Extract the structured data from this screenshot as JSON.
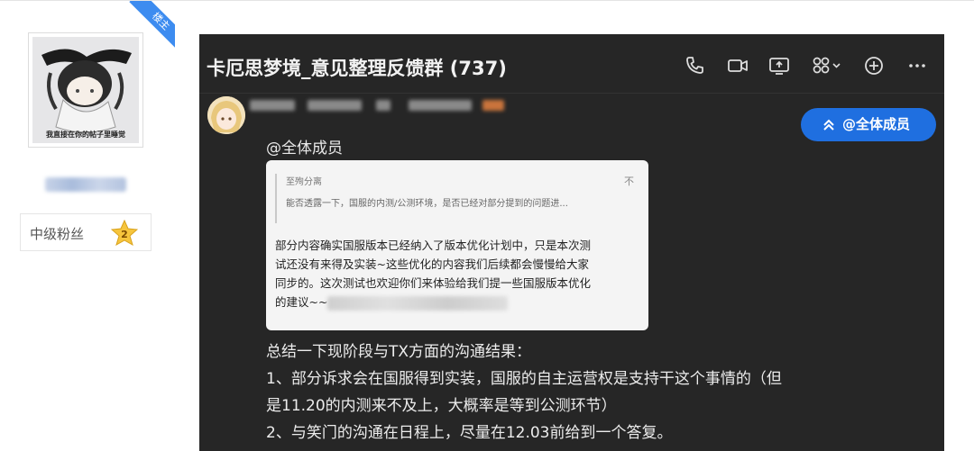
{
  "poster": {
    "badge": "楼主",
    "avatar_caption": "我直接在你的帖子里睡觉",
    "fan_level_label": "中级粉丝",
    "fan_level_number": "2"
  },
  "chat": {
    "title": "卡厄思梦境_意见整理反馈群 (737)",
    "header_icons": [
      "phone-icon",
      "video-icon",
      "screen-share-icon",
      "apps-icon",
      "add-circle-icon",
      "more-icon"
    ],
    "mention_all_button": "@全体成员",
    "mention_text": "@全体成员",
    "quote": {
      "label": "至殉分离",
      "close": "不",
      "snippet": "能否透露一下，国服的内测/公测环境，是否已经对部分提到的问题进...",
      "reply_lines": [
        "部分内容确实国服版本已经纳入了版本优化计划中，只是本次测",
        "试还没有来得及实装~这些优化的内容我们后续都会慢慢给大家",
        "同步的。这次测试也欢迎你们来体验给我们提一些国服版本优化",
        "的建议~~"
      ]
    },
    "body_lines": [
      "总结一下现阶段与TX方面的沟通结果：",
      "1、部分诉求会在国服得到实装，国服的自主运营权是支持干这个事情的（但",
      "是11.20的内测来不及上，大概率是等到公测环节）",
      "2、与笑门的沟通在日程上，尽量在12.03前给到一个答复。"
    ],
    "colors": {
      "panel": "#262626",
      "accent_button": "#1f6fe0",
      "quote_bg": "#f4f4f4"
    }
  }
}
